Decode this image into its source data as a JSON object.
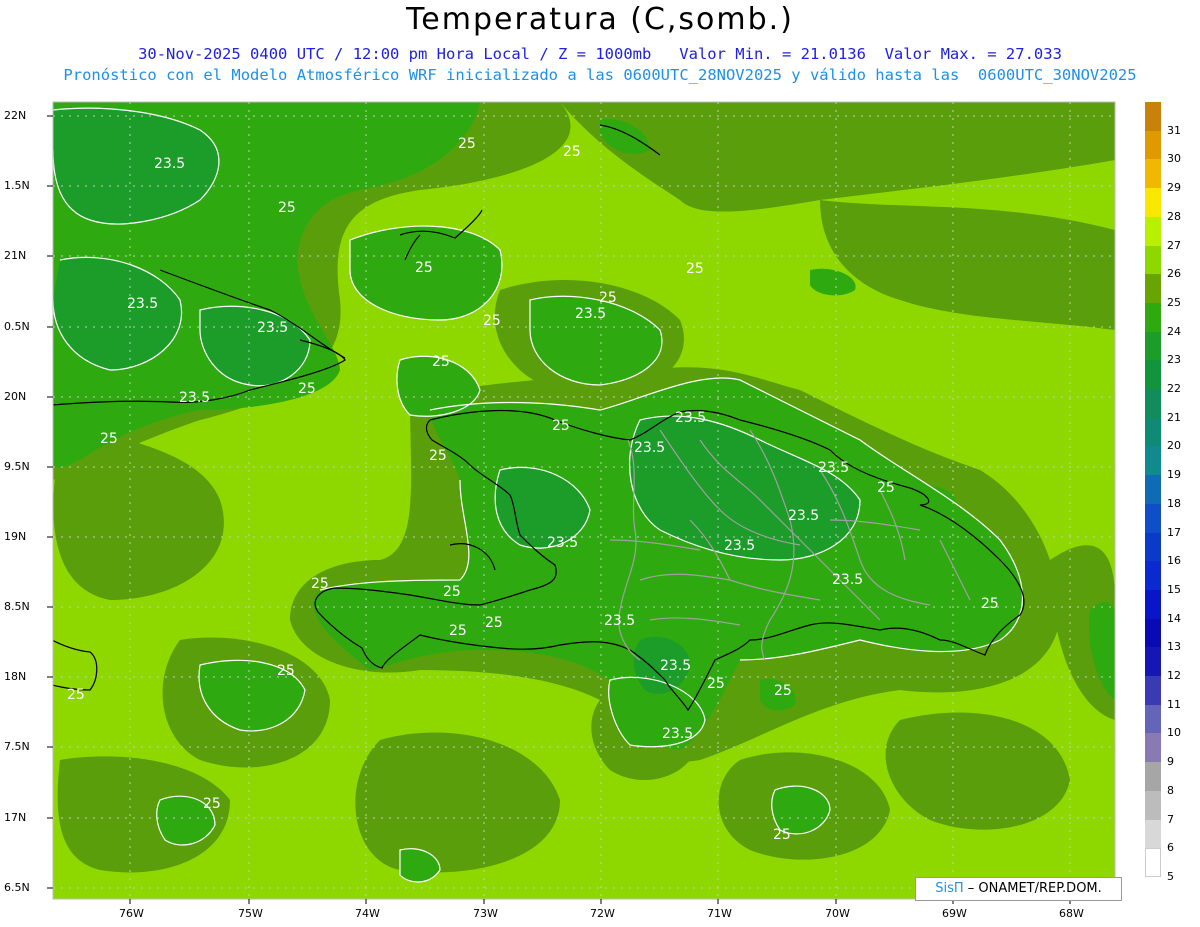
{
  "title": "Temperatura (C,somb.)",
  "line1": "30-Nov-2025 0400 UTC / 12:00 pm Hora Local / Z = 1000mb   Valor Min. = 21.0136  Valor Max. = 27.033",
  "line2": "Pronóstico con el Modelo Atmosférico WRF inicializado a las 0600UTC_28NOV2025 y válido hasta las  0600UTC_30NOV2025",
  "credit": {
    "brand": "SisΠ",
    "org": " – ONAMET/REP.DOM."
  },
  "lat_labels": [
    "22N",
    "1.5N",
    "21N",
    "0.5N",
    "20N",
    "9.5N",
    "19N",
    "8.5N",
    "18N",
    "7.5N",
    "17N",
    "6.5N"
  ],
  "lon_labels": [
    "76W",
    "75W",
    "74W",
    "73W",
    "72W",
    "71W",
    "70W",
    "69W",
    "68W"
  ],
  "contour_labels": [
    "25",
    "23.5"
  ],
  "colorbar": {
    "labels": [
      "31",
      "30",
      "29",
      "28",
      "27",
      "26",
      "25",
      "24",
      "23",
      "22",
      "21",
      "20",
      "19",
      "18",
      "17",
      "16",
      "15",
      "14",
      "13",
      "12",
      "11",
      "10",
      "9",
      "8",
      "7",
      "6",
      "5"
    ],
    "colors": [
      "#c8820a",
      "#e09a00",
      "#f0b800",
      "#f8e800",
      "#b8f000",
      "#8ed800",
      "#6aa400",
      "#2eaa10",
      "#1c9c28",
      "#12943c",
      "#128c5a",
      "#0f8a74",
      "#118a8e",
      "#0f6cb4",
      "#0f4ec8",
      "#0a3ac8",
      "#0a2ad0",
      "#0a14c8",
      "#0a0ab4",
      "#1616b4",
      "#3a3ab4",
      "#6464b8",
      "#8a7ab4",
      "#a6a6a6",
      "#bcbcbc",
      "#d8d8d8",
      "#ffffff"
    ]
  },
  "field_colors": {
    "c24": "#2eaa10",
    "c25": "#5a9e0c",
    "c26": "#8ed800",
    "c23": "#1c9c28"
  }
}
